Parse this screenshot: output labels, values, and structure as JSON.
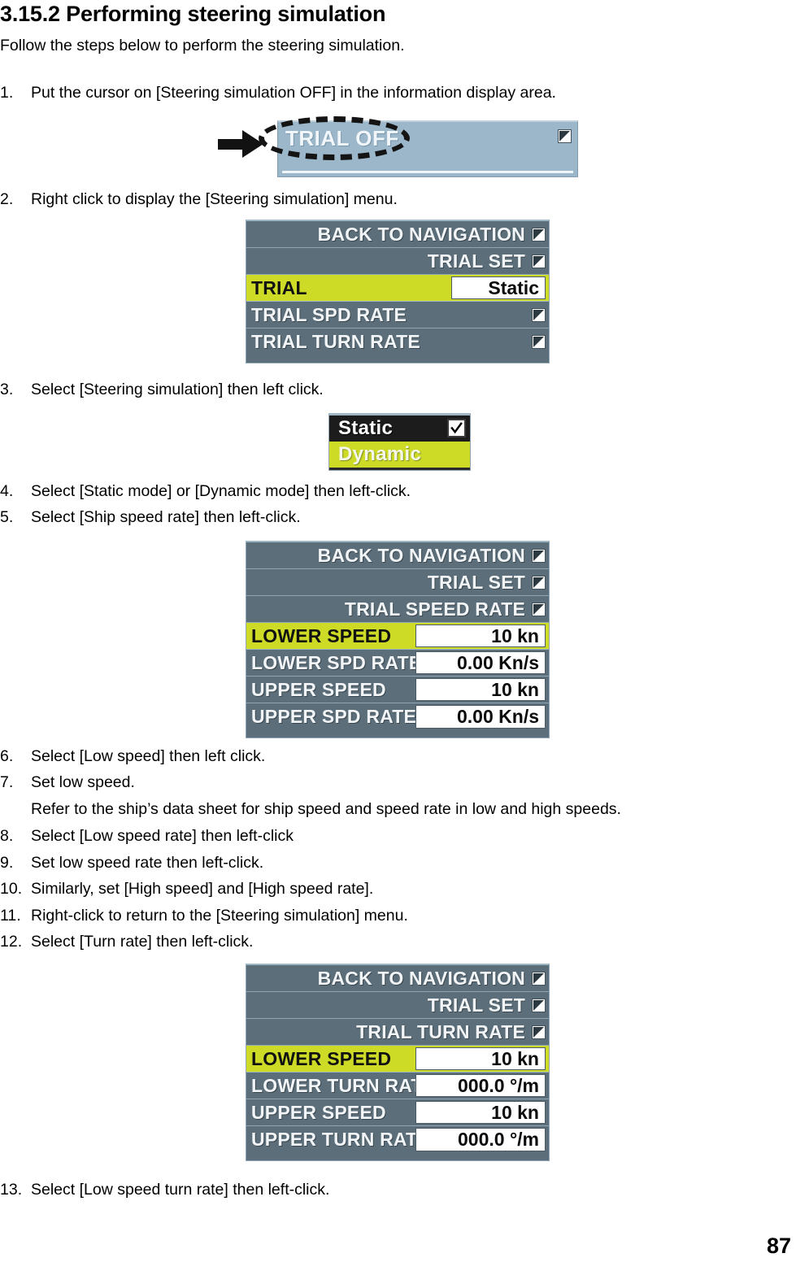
{
  "document": {
    "heading": "3.15.2 Performing steering simulation",
    "intro": "Follow the steps below to perform the steering simulation.",
    "page_number": "87"
  },
  "steps": [
    {
      "num": "1.",
      "text": "Put the cursor on [Steering simulation OFF] in the information display area."
    },
    {
      "num": "2.",
      "text": "Right click to display the [Steering simulation] menu."
    },
    {
      "num": "3.",
      "text": "Select [Steering simulation] then left click."
    },
    {
      "num": "4.",
      "text": "Select [Static mode] or [Dynamic mode] then left-click."
    },
    {
      "num": "5.",
      "text": "Select [Ship speed rate] then left-click."
    },
    {
      "num": "6.",
      "text": "Select [Low speed] then left click."
    },
    {
      "num": "7.",
      "text": "Set low speed."
    },
    {
      "num": "8.",
      "text": "Select [Low speed rate] then left-click"
    },
    {
      "num": "9.",
      "text": "Set low speed rate then left-click."
    },
    {
      "num": "10.",
      "text": "Similarly, set [High speed] and [High speed rate]."
    },
    {
      "num": "11.",
      "text": "Right-click to return to the [Steering simulation] menu."
    },
    {
      "num": "12.",
      "text": "Select [Turn rate] then left-click."
    },
    {
      "num": "13.",
      "text": "Select [Low speed turn rate] then left-click."
    }
  ],
  "notes": {
    "step7_note": "Refer to the ship’s data sheet for ship speed and speed rate in low and high speeds."
  },
  "trial_banner": {
    "label": "TRIAL OFF",
    "icon": "submenu-fold-icon",
    "background_color": "#9cb7ca",
    "text_color": "#f1f6fa"
  },
  "menu_trial": {
    "rows": [
      {
        "label": "BACK TO NAVIGATION",
        "align": "right",
        "icon": "submenu-fold-icon",
        "selected": false,
        "value": null
      },
      {
        "label": "TRIAL SET",
        "align": "right",
        "icon": "submenu-fold-icon",
        "selected": false,
        "value": null
      },
      {
        "label": "TRIAL",
        "align": "left",
        "icon": null,
        "selected": true,
        "value": "Static"
      },
      {
        "label": "TRIAL SPD RATE",
        "align": "left",
        "icon": "submenu-fold-icon",
        "selected": false,
        "value": null
      },
      {
        "label": "TRIAL TURN RATE",
        "align": "left",
        "icon": "submenu-fold-icon",
        "selected": false,
        "value": null
      }
    ]
  },
  "static_dynamic_popup": {
    "options": [
      {
        "label": "Static",
        "checked": true,
        "highlighted": false
      },
      {
        "label": "Dynamic",
        "checked": false,
        "highlighted": true
      }
    ],
    "check_icon": "check-mark-icon"
  },
  "menu_speed_rate": {
    "rows": [
      {
        "label": "BACK TO NAVIGATION",
        "align": "right",
        "icon": "submenu-fold-icon",
        "selected": false,
        "value": null
      },
      {
        "label": "TRIAL SET",
        "align": "right",
        "icon": "submenu-fold-icon",
        "selected": false,
        "value": null
      },
      {
        "label": "TRIAL SPEED RATE",
        "align": "right",
        "icon": "submenu-fold-icon",
        "selected": false,
        "value": null
      },
      {
        "label": "LOWER SPEED",
        "align": "left",
        "icon": null,
        "selected": true,
        "value": "10 kn"
      },
      {
        "label": "LOWER SPD RATE",
        "align": "left",
        "icon": null,
        "selected": false,
        "value": "0.00 Kn/s"
      },
      {
        "label": "UPPER SPEED",
        "align": "left",
        "icon": null,
        "selected": false,
        "value": "10 kn"
      },
      {
        "label": "UPPER SPD RATE",
        "align": "left",
        "icon": null,
        "selected": false,
        "value": "0.00 Kn/s"
      }
    ]
  },
  "menu_turn_rate": {
    "rows": [
      {
        "label": "BACK TO NAVIGATION",
        "align": "right",
        "icon": "submenu-fold-icon",
        "selected": false,
        "value": null
      },
      {
        "label": "TRIAL SET",
        "align": "right",
        "icon": "submenu-fold-icon",
        "selected": false,
        "value": null
      },
      {
        "label": "TRIAL TURN RATE",
        "align": "right",
        "icon": "submenu-fold-icon",
        "selected": false,
        "value": null
      },
      {
        "label": "LOWER SPEED",
        "align": "left",
        "icon": null,
        "selected": true,
        "value": "10 kn"
      },
      {
        "label": "LOWER TURN RATE",
        "align": "left",
        "icon": null,
        "selected": false,
        "value": "000.0 °/m"
      },
      {
        "label": "UPPER SPEED",
        "align": "left",
        "icon": null,
        "selected": false,
        "value": "10 kn"
      },
      {
        "label": "UPPER TURN RATE",
        "align": "left",
        "icon": null,
        "selected": false,
        "value": "000.0 °/m"
      }
    ]
  },
  "colors": {
    "menu_background": "#5b6e79",
    "menu_highlight": "#cddb27",
    "banner_background": "#9cb7ca",
    "value_box_background": "#ffffff"
  }
}
